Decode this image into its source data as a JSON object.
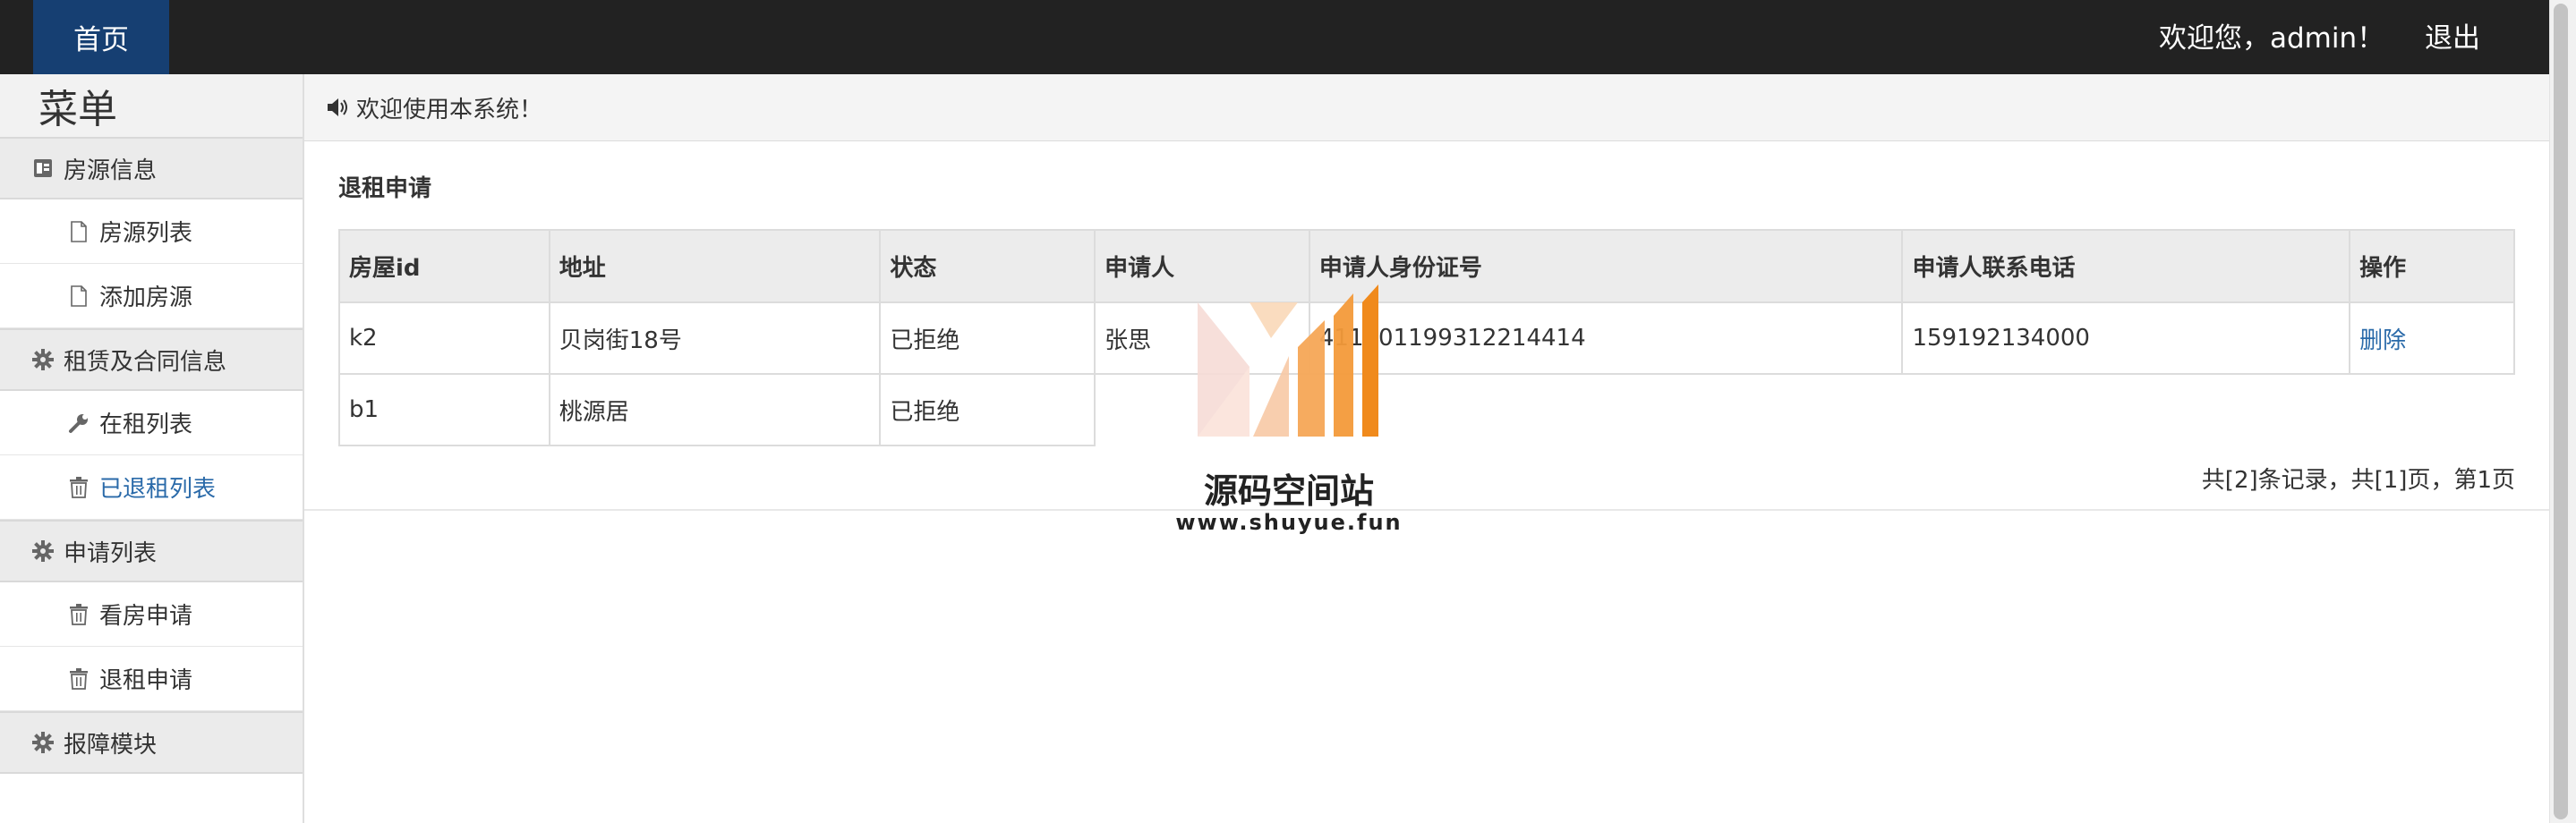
{
  "navbar": {
    "home_label": "首页",
    "welcome_text": "欢迎您，admin！",
    "logout_label": "退出"
  },
  "sidebar": {
    "title": "菜单",
    "groups": [
      {
        "label": "房源信息",
        "icon": "id-card-icon",
        "items": [
          {
            "label": "房源列表",
            "icon": "file-icon"
          },
          {
            "label": "添加房源",
            "icon": "file-icon"
          }
        ]
      },
      {
        "label": "租赁及合同信息",
        "icon": "gear-icon",
        "items": [
          {
            "label": "在租列表",
            "icon": "wrench-icon"
          },
          {
            "label": "已退租列表",
            "icon": "trash-icon",
            "active": true
          }
        ]
      },
      {
        "label": "申请列表",
        "icon": "gear-icon",
        "items": [
          {
            "label": "看房申请",
            "icon": "trash-icon"
          },
          {
            "label": "退租申请",
            "icon": "trash-icon"
          }
        ]
      },
      {
        "label": "报障模块",
        "icon": "gear-icon",
        "items": []
      }
    ]
  },
  "notice": {
    "icon": "speaker-icon",
    "text": "欢迎使用本系统！"
  },
  "main": {
    "section_title": "退租申请",
    "table": {
      "headers": [
        "房屋id",
        "地址",
        "状态",
        "申请人",
        "申请人身份证号",
        "申请人联系电话",
        "操作"
      ],
      "rows": [
        {
          "house_id": "k2",
          "address": "贝岗街18号",
          "status": "已拒绝",
          "applicant": "张思",
          "id_number": "411301199312214414",
          "phone": "159192134000",
          "action": "删除"
        },
        {
          "house_id": "b1",
          "address": "桃源居",
          "status": "已拒绝"
        }
      ]
    },
    "pagination": "共[2]条记录，共[1]页，第1页"
  },
  "watermark": {
    "title": "源码空间站",
    "url": "www.shuyue.fun"
  },
  "colors": {
    "navbar_bg": "#222222",
    "nav_active_bg": "#163f72",
    "link": "#2a6aa9",
    "watermark_orange": "#f08a1c"
  }
}
